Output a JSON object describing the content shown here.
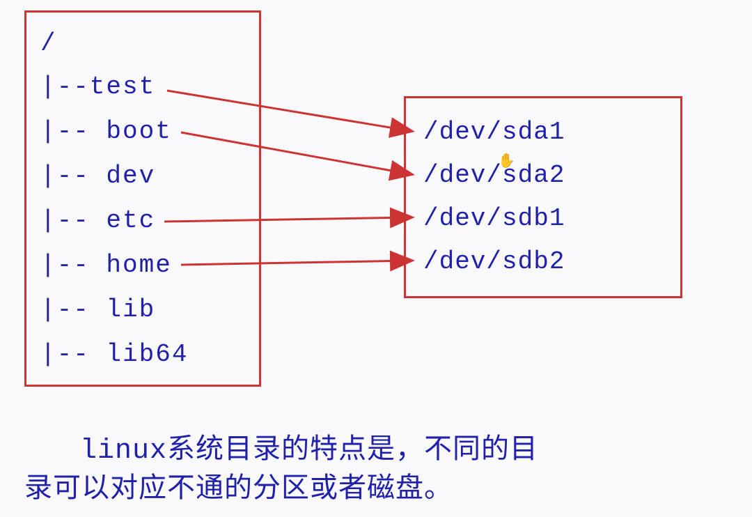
{
  "tree": {
    "root": "/",
    "items": [
      "|--test",
      "|-- boot",
      "|-- dev",
      "|-- etc",
      "|-- home",
      "|-- lib",
      "|-- lib64"
    ]
  },
  "devices": {
    "items": [
      "/dev/sda1",
      "/dev/sda2",
      "/dev/sdb1",
      "/dev/sdb2"
    ]
  },
  "arrows": [
    {
      "from": "test",
      "to": "/dev/sda1"
    },
    {
      "from": "boot",
      "to": "/dev/sda2"
    },
    {
      "from": "etc",
      "to": "/dev/sdb1"
    },
    {
      "from": "home",
      "to": "/dev/sdb2"
    }
  ],
  "caption": {
    "line1_prefix": "linux",
    "line1_rest": "系统目录的特点是，不同的目",
    "line2": "录可以对应不通的分区或者磁盘。"
  },
  "colors": {
    "text": "#2020aa",
    "border": "#cc3333",
    "arrow": "#cc3333",
    "bg": "#f9f9fb"
  }
}
